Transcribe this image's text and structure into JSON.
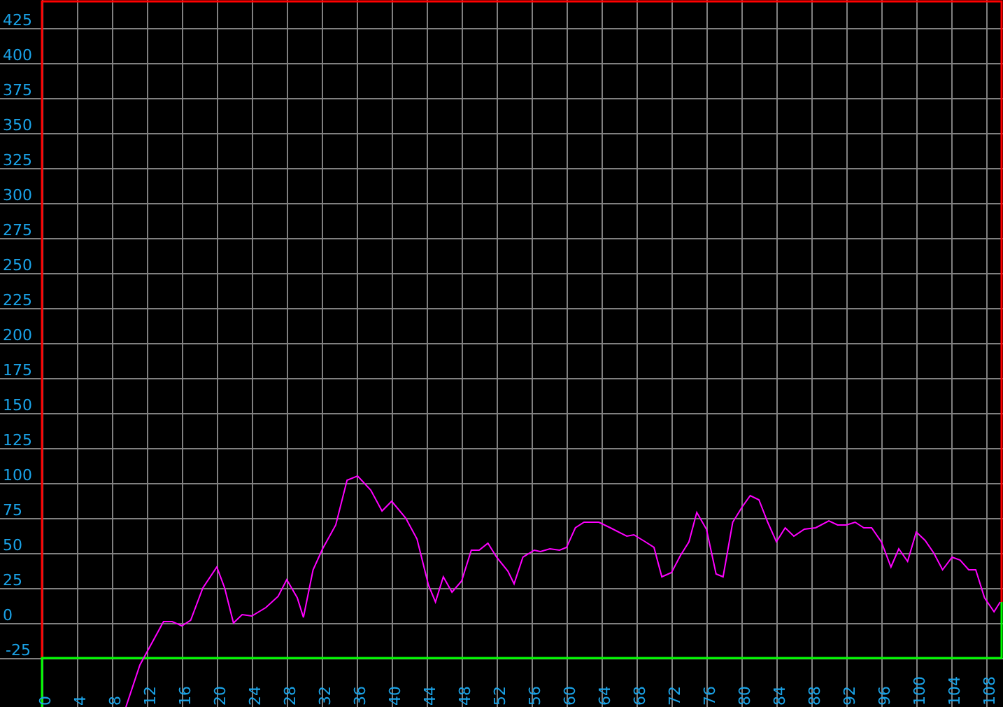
{
  "chart": {
    "chart_data": {
      "type": "line",
      "grid": true,
      "x": [
        9.6,
        11.2,
        13.9,
        14.9,
        16,
        17,
        18.4,
        20,
        20.9,
        21.9,
        22.9,
        24,
        25.6,
        27,
        28,
        29.2,
        29.9,
        31,
        32.1,
        33.6,
        34.9,
        36.1,
        37.6,
        38.9,
        40,
        41.6,
        42.9,
        44.2,
        45,
        45.9,
        46.9,
        48,
        49.1,
        50,
        51,
        52,
        53.3,
        54,
        55,
        56.3,
        57,
        58.1,
        59.2,
        60,
        61,
        62,
        63.7,
        65,
        66.9,
        67.7,
        69,
        70,
        70.9,
        72,
        73,
        74,
        74.9,
        76,
        77.1,
        77.9,
        79,
        80.1,
        81,
        82,
        83,
        84,
        85,
        86,
        87.2,
        88.5,
        90,
        91,
        92,
        93,
        94,
        94.9,
        96,
        97.1,
        98,
        99,
        100,
        101,
        102,
        103,
        104.1,
        105,
        106,
        106.8,
        107.8,
        108.9,
        109.6
      ],
      "series": [
        {
          "color": "#ff00ff",
          "values": [
            -60,
            -30,
            1,
            1,
            -2,
            2,
            25,
            40,
            25,
            0,
            6,
            5,
            11,
            19,
            31,
            18,
            4,
            38,
            53,
            70,
            102,
            105,
            95,
            80,
            87,
            75,
            60,
            27,
            15,
            33,
            22,
            30,
            52,
            52,
            57,
            47,
            37,
            28,
            47,
            52,
            51,
            53,
            52,
            54,
            68,
            72,
            72,
            68,
            62,
            63,
            58,
            54,
            33,
            36,
            48,
            58,
            79,
            67,
            35,
            33,
            72,
            83,
            91,
            88,
            72,
            58,
            68,
            62,
            67,
            68,
            73,
            70,
            70,
            72,
            68,
            68,
            58,
            40,
            53,
            44,
            65,
            59,
            50,
            38,
            47,
            45,
            38,
            38,
            18,
            8,
            15
          ]
        }
      ],
      "xlim": [
        0,
        109.76
      ],
      "ylim": [
        -60,
        445
      ],
      "xticks": [
        0,
        4,
        8,
        12,
        16,
        20,
        24,
        28,
        32,
        36,
        40,
        44,
        48,
        52,
        56,
        60,
        64,
        68,
        72,
        76,
        80,
        84,
        88,
        92,
        96,
        100,
        104,
        108
      ],
      "yticks": [
        -25,
        0,
        25,
        50,
        75,
        100,
        125,
        150,
        175,
        200,
        225,
        250,
        275,
        300,
        325,
        350,
        375,
        400,
        425
      ]
    }
  }
}
